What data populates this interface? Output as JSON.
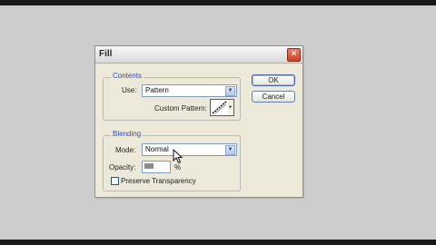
{
  "dialog": {
    "title": "Fill",
    "close_glyph": "×",
    "ok_label": "OK",
    "cancel_label": "Cancel"
  },
  "contents": {
    "group_label": "Contents",
    "use_label": "Use:",
    "use_value": "Pattern",
    "custom_pattern_label": "Custom Pattern:"
  },
  "blending": {
    "group_label": "Blending",
    "mode_label": "Mode:",
    "mode_value": "Normal",
    "opacity_label": "Opacity:",
    "opacity_unit": "%",
    "preserve_label": "Preserve Transparency",
    "preserve_checked": false
  },
  "icons": {
    "dropdown": "chevron-down-icon",
    "close": "close-icon",
    "pattern": "diagonal-pattern-icon",
    "cursor": "mouse-pointer-icon"
  },
  "colors": {
    "group_label": "#2d4fb3",
    "close_button": "#c44428",
    "dialog_bg": "#ece9d8"
  }
}
